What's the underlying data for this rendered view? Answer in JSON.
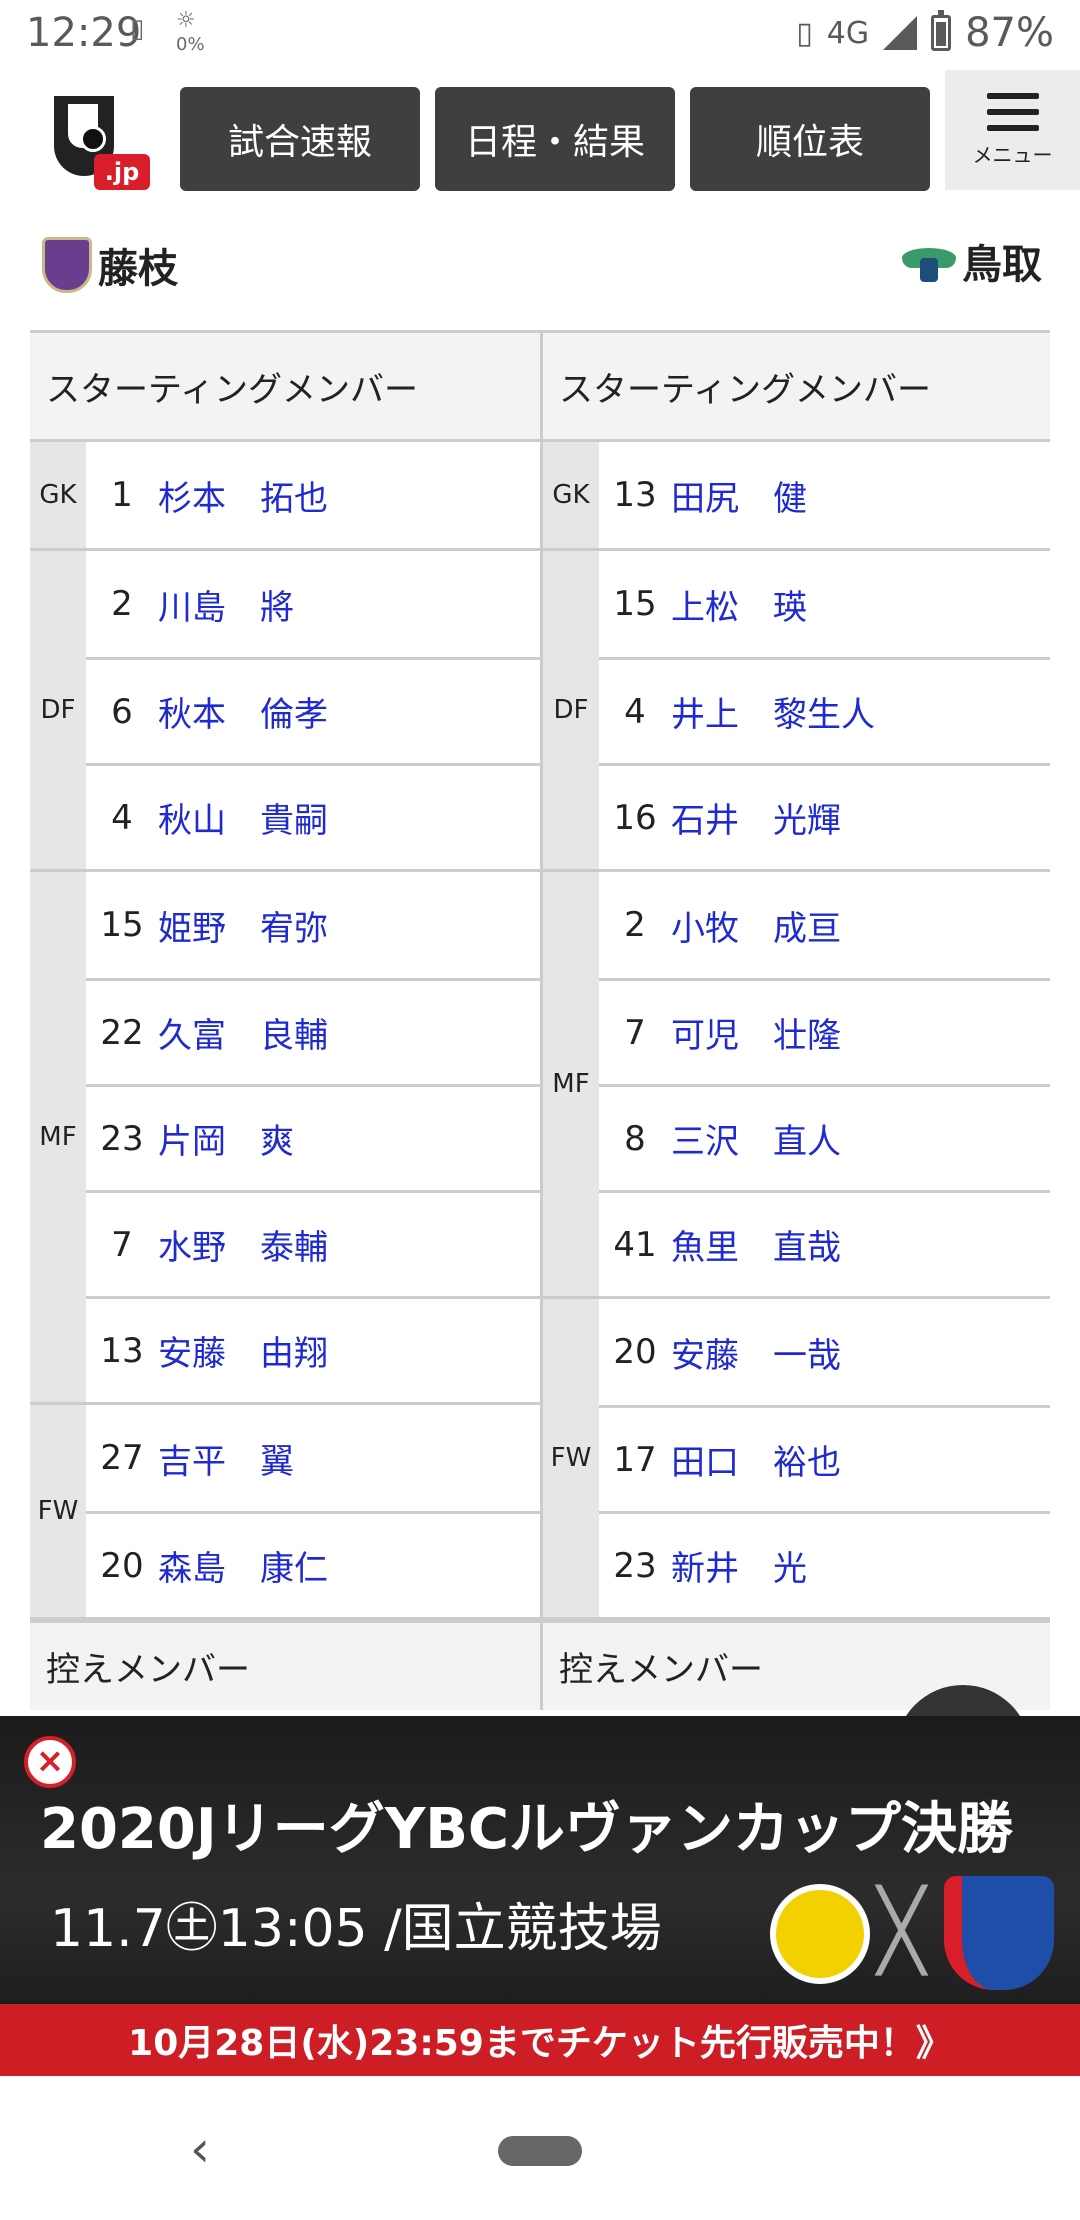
{
  "status_bar": {
    "time": "12:29",
    "data_rate": "0%",
    "network": "4G",
    "battery": "87%"
  },
  "header": {
    "logo_text": ".jp",
    "nav": [
      "試合速報",
      "日程・結果",
      "順位表"
    ],
    "menu_label": "メニュー"
  },
  "teams": {
    "home": "藤枝",
    "away": "鳥取"
  },
  "lineup": {
    "starting_label": "スターティングメンバー",
    "subs_label": "控えメンバー",
    "home": [
      {
        "pos": "GK",
        "players": [
          {
            "num": "1",
            "name": "杉本　拓也"
          }
        ]
      },
      {
        "pos": "DF",
        "players": [
          {
            "num": "2",
            "name": "川島　將"
          },
          {
            "num": "6",
            "name": "秋本　倫孝"
          },
          {
            "num": "4",
            "name": "秋山　貴嗣"
          }
        ]
      },
      {
        "pos": "MF",
        "players": [
          {
            "num": "15",
            "name": "姫野　宥弥"
          },
          {
            "num": "22",
            "name": "久富　良輔"
          },
          {
            "num": "23",
            "name": "片岡　爽"
          },
          {
            "num": "7",
            "name": "水野　泰輔"
          },
          {
            "num": "13",
            "name": "安藤　由翔"
          }
        ]
      },
      {
        "pos": "FW",
        "players": [
          {
            "num": "27",
            "name": "吉平　翼"
          },
          {
            "num": "20",
            "name": "森島　康仁"
          }
        ]
      }
    ],
    "away": [
      {
        "pos": "GK",
        "players": [
          {
            "num": "13",
            "name": "田尻　健"
          }
        ]
      },
      {
        "pos": "DF",
        "players": [
          {
            "num": "15",
            "name": "上松　瑛"
          },
          {
            "num": "4",
            "name": "井上　黎生人"
          },
          {
            "num": "16",
            "name": "石井　光輝"
          }
        ]
      },
      {
        "pos": "MF",
        "players": [
          {
            "num": "2",
            "name": "小牧　成亘"
          },
          {
            "num": "7",
            "name": "可児　壮隆"
          },
          {
            "num": "8",
            "name": "三沢　直人"
          },
          {
            "num": "41",
            "name": "魚里　直哉"
          }
        ]
      },
      {
        "pos": "FW",
        "players": [
          {
            "num": "20",
            "name": "安藤　一哉"
          },
          {
            "num": "17",
            "name": "田口　裕也"
          },
          {
            "num": "23",
            "name": "新井　光"
          }
        ]
      }
    ]
  },
  "ad": {
    "title": "2020JリーグYBCルヴァンカップ決勝",
    "date": "11.7㊏13:05 /国立競技場",
    "vs": "╳",
    "banner": "10月28日(水)23:59までチケット先行販売中！》",
    "close": "×"
  },
  "nav_bar": {
    "back": "‹"
  }
}
